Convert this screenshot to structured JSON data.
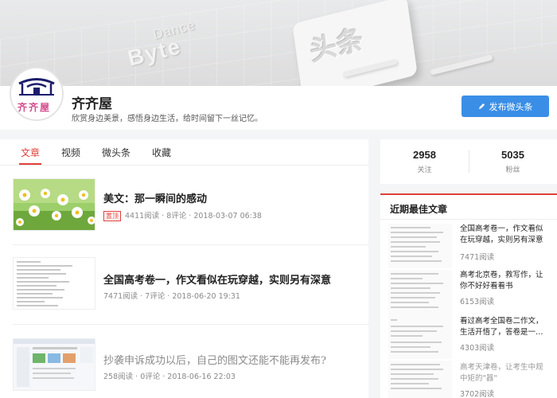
{
  "banner": {
    "brand_word_1": "Dance",
    "brand_word_2": "Byte",
    "logo_text": "头条"
  },
  "profile": {
    "avatar_text": "齐齐屋",
    "name": "齐齐屋",
    "bio": "欣赏身边美景，感悟身边生活，给时间留下一丝记忆。",
    "publish_button": "发布微头条"
  },
  "tabs": [
    "文章",
    "视频",
    "微头条",
    "收藏"
  ],
  "active_tab": "文章",
  "articles": [
    {
      "title": "美文：那一瞬间的感动",
      "pinned_label": "置顶",
      "meta": "4411阅读 · 8评论 · 2018-03-07 06:38",
      "thumb": "daisy-flowers-image"
    },
    {
      "title": "全国高考卷一，作文看似在玩穿越，实则另有深意",
      "pinned_label": "",
      "meta": "7471阅读 · 7评论 · 2018-06-20 19:31",
      "thumb": "document-screenshot-image"
    },
    {
      "title": "抄袭申诉成功以后，自己的图文还能不能再发布?",
      "pinned_label": "",
      "meta": "258阅读 · 0评论 · 2018-06-16 22:03",
      "thumb": "webpage-screenshot-image"
    }
  ],
  "stats": {
    "following_count": "2958",
    "following_label": "关注",
    "fans_count": "5035",
    "fans_label": "粉丝"
  },
  "best_articles": {
    "heading": "近期最佳文章",
    "items": [
      {
        "title": "全国高考卷一，作文看似在玩穿越，实则另有深意",
        "reads": "7471阅读"
      },
      {
        "title": "高考北京卷，救写作，让你不好好看看书",
        "reads": "6153阅读"
      },
      {
        "title": "看过高考全国卷二作文，生活开悟了，答卷是一…",
        "reads": "4303阅读"
      },
      {
        "title": "高考天津卷，让考生中规中矩的\"器\"",
        "reads": "3702阅读"
      }
    ]
  },
  "colors": {
    "accent_red": "#e0403a",
    "button_blue": "#3a8ee6"
  }
}
